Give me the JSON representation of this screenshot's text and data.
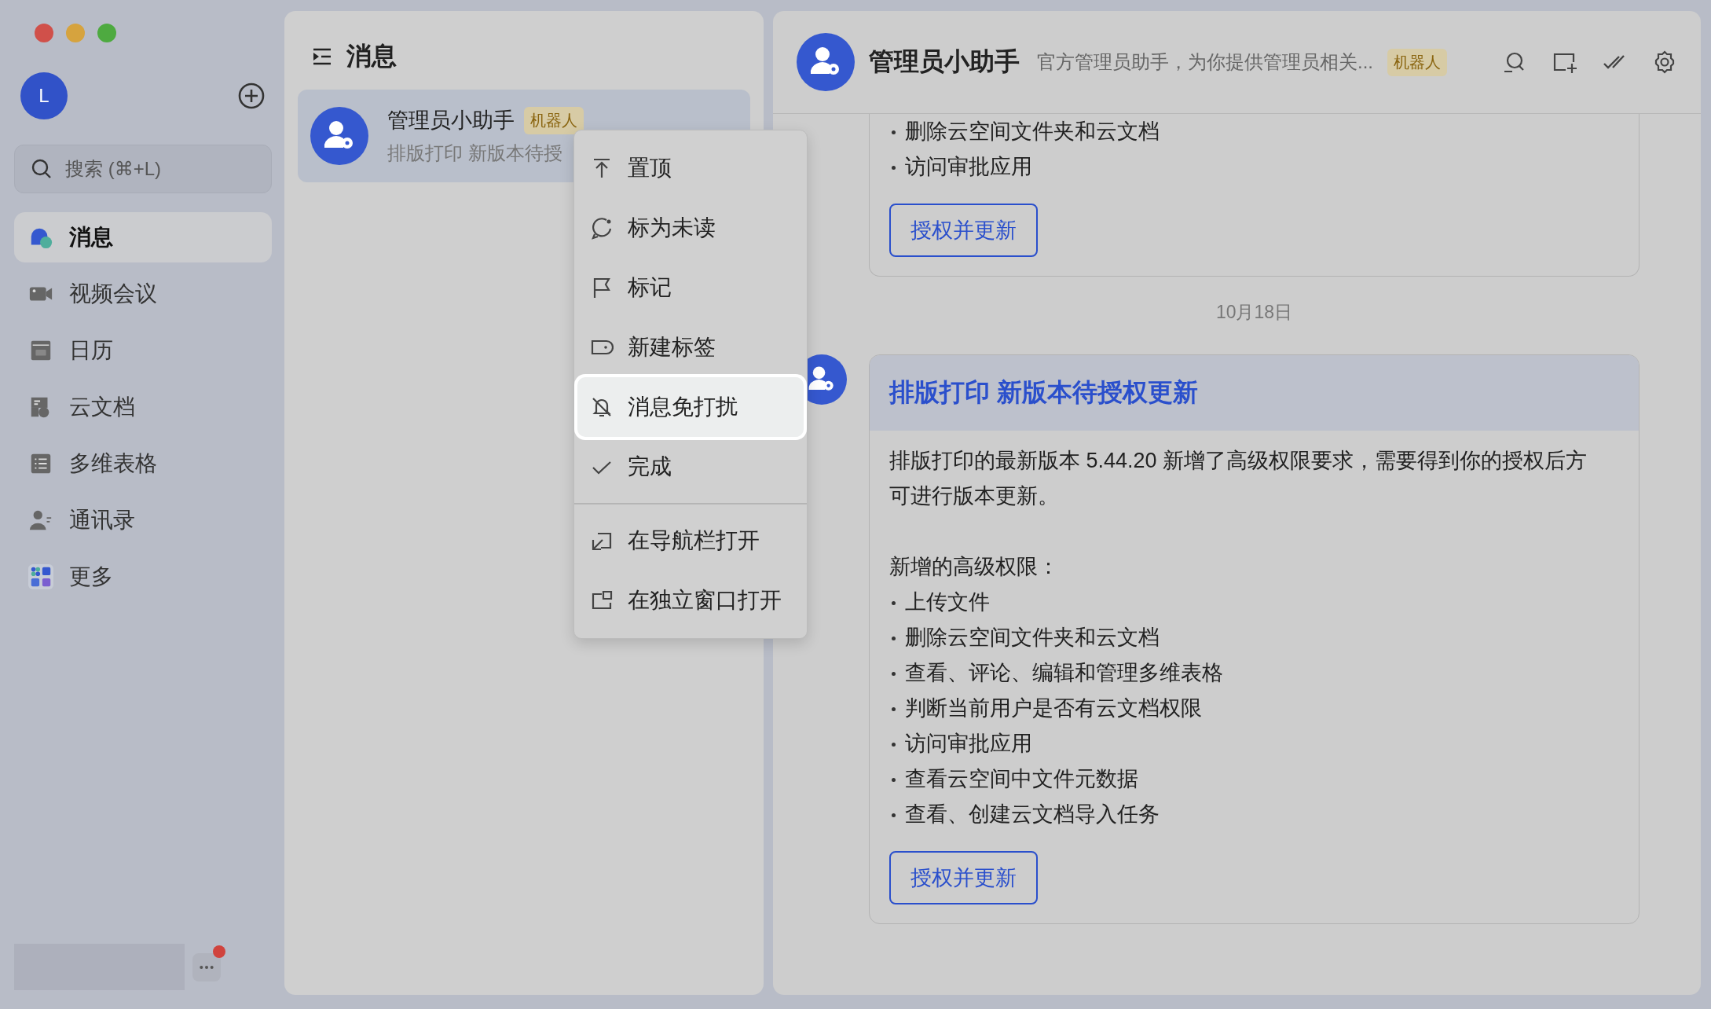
{
  "user": {
    "avatar": "L"
  },
  "search": {
    "placeholder": "搜索 (⌘+L)"
  },
  "nav": [
    {
      "label": "消息",
      "kind": "messages",
      "selected": true
    },
    {
      "label": "视频会议",
      "kind": "video",
      "selected": false
    },
    {
      "label": "日历",
      "kind": "calendar",
      "selected": false
    },
    {
      "label": "云文档",
      "kind": "docs",
      "selected": false
    },
    {
      "label": "多维表格",
      "kind": "sheets",
      "selected": false
    },
    {
      "label": "通讯录",
      "kind": "contacts",
      "selected": false
    },
    {
      "label": "更多",
      "kind": "more",
      "selected": false
    }
  ],
  "more_button": {
    "notification_dot": true
  },
  "chat_list": {
    "title": "消息",
    "items": [
      {
        "name": "管理员小助手",
        "badge": "机器人",
        "preview": "排版打印 新版本待授",
        "selected": true
      }
    ]
  },
  "context_menu": {
    "groups": [
      [
        {
          "label": "置顶",
          "kind": "pin",
          "selected": false
        },
        {
          "label": "标为未读",
          "kind": "unread",
          "selected": false
        },
        {
          "label": "标记",
          "kind": "flag",
          "selected": false
        },
        {
          "label": "新建标签",
          "kind": "label",
          "selected": false
        },
        {
          "label": "消息免打扰",
          "kind": "mute",
          "selected": true
        },
        {
          "label": "完成",
          "kind": "done",
          "selected": false
        }
      ],
      [
        {
          "label": "在导航栏打开",
          "kind": "nav-open",
          "selected": false
        },
        {
          "label": "在独立窗口打开",
          "kind": "window-open",
          "selected": false
        }
      ]
    ]
  },
  "chat": {
    "title": "管理员小助手",
    "description": "官方管理员助手，为你提供管理员相关...",
    "badge": "机器人",
    "messages": [
      {
        "kind": "card",
        "bullets": [
          "删除云空间文件夹和云文档",
          "访问审批应用"
        ],
        "button": "授权并更新"
      },
      {
        "kind": "date",
        "text": "10月18日"
      },
      {
        "kind": "card",
        "title": "排版打印 新版本待授权更新",
        "paragraph": "排版打印的最新版本 5.44.20 新增了高级权限要求，需要得到你的授权后方可进行版本更新。",
        "list_title": "新增的高级权限：",
        "bullets": [
          "上传文件",
          "删除云空间文件夹和云文档",
          "查看、评论、编辑和管理多维表格",
          "判断当前用户是否有云文档权限",
          "访问审批应用",
          "查看云空间中文件元数据",
          "查看、创建云文档导入任务"
        ],
        "button": "授权并更新"
      }
    ]
  }
}
